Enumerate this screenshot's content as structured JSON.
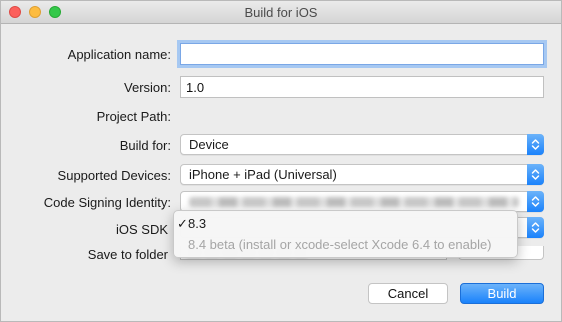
{
  "window": {
    "title": "Build for iOS"
  },
  "form": {
    "application_name": {
      "label": "Application name:",
      "value": ""
    },
    "version": {
      "label": "Version:",
      "value": "1.0"
    },
    "project_path": {
      "label": "Project Path:"
    },
    "build_for": {
      "label": "Build for:",
      "value": "Device"
    },
    "supported_devices": {
      "label": "Supported Devices:",
      "value": "iPhone + iPad (Universal)"
    },
    "code_signing_identity": {
      "label": "Code Signing Identity:"
    },
    "ios_sdk": {
      "label": "iOS SDK",
      "options": [
        {
          "label": "8.3",
          "checked": true,
          "enabled": true
        },
        {
          "label": "8.4 beta (install or xcode-select Xcode 6.4 to enable)",
          "checked": false,
          "enabled": false
        }
      ]
    },
    "save_to_folder": {
      "label": "Save to folder"
    }
  },
  "buttons": {
    "cancel": "Cancel",
    "build": "Build"
  },
  "icons": {
    "checkmark": "✓",
    "popup_arrows": "updown-chevron-icon"
  },
  "colors": {
    "accent": "#1a82fb",
    "disabled_text": "#a5a5a5"
  }
}
